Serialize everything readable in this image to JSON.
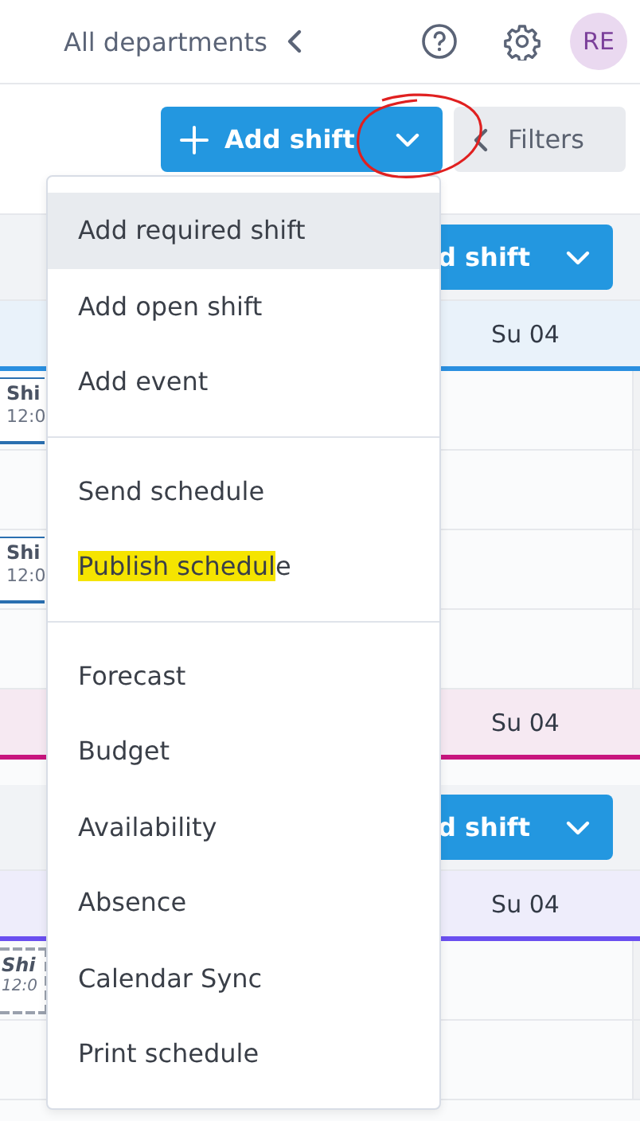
{
  "topbar": {
    "department": "All departments",
    "avatar": "RE"
  },
  "toolbar": {
    "add_button": "Add shift",
    "filters": "Filters"
  },
  "sections": [
    {
      "color": "#2a8fe0",
      "action": "d shift",
      "day": "Su 04",
      "rows": [
        {
          "shift": {
            "kind": "assigned",
            "title": "Shi",
            "time": "12:0"
          }
        },
        {
          "shift": null
        },
        {
          "shift": {
            "kind": "assigned",
            "title": "Shi",
            "time": "12:0"
          }
        },
        {
          "shift": null
        }
      ]
    },
    {
      "color": "#c8157e",
      "day": "Su 04"
    },
    {
      "color": "#6a4ff0",
      "action": "d shift",
      "day": "Su 04",
      "rows": [
        {
          "shift": {
            "kind": "open",
            "title": "Shi",
            "time": "12:0"
          }
        },
        {
          "shift": null
        }
      ]
    }
  ],
  "menu": {
    "groups": [
      [
        {
          "label": "Add required shift",
          "selected": true
        },
        {
          "label": "Add open shift",
          "selected": false
        },
        {
          "label": "Add event",
          "selected": false
        }
      ],
      [
        {
          "label": "Send schedule",
          "selected": false
        },
        {
          "parts": [
            {
              "text": "Publish schedul",
              "marked": true
            },
            {
              "text": "e",
              "marked": false
            }
          ],
          "selected": false
        }
      ],
      [
        {
          "label": "Forecast",
          "selected": false
        },
        {
          "label": "Budget",
          "selected": false
        },
        {
          "label": "Availability",
          "selected": false
        },
        {
          "label": "Absence",
          "selected": false
        },
        {
          "label": "Calendar Sync",
          "selected": false
        },
        {
          "label": "Print schedule",
          "selected": false
        }
      ]
    ]
  }
}
